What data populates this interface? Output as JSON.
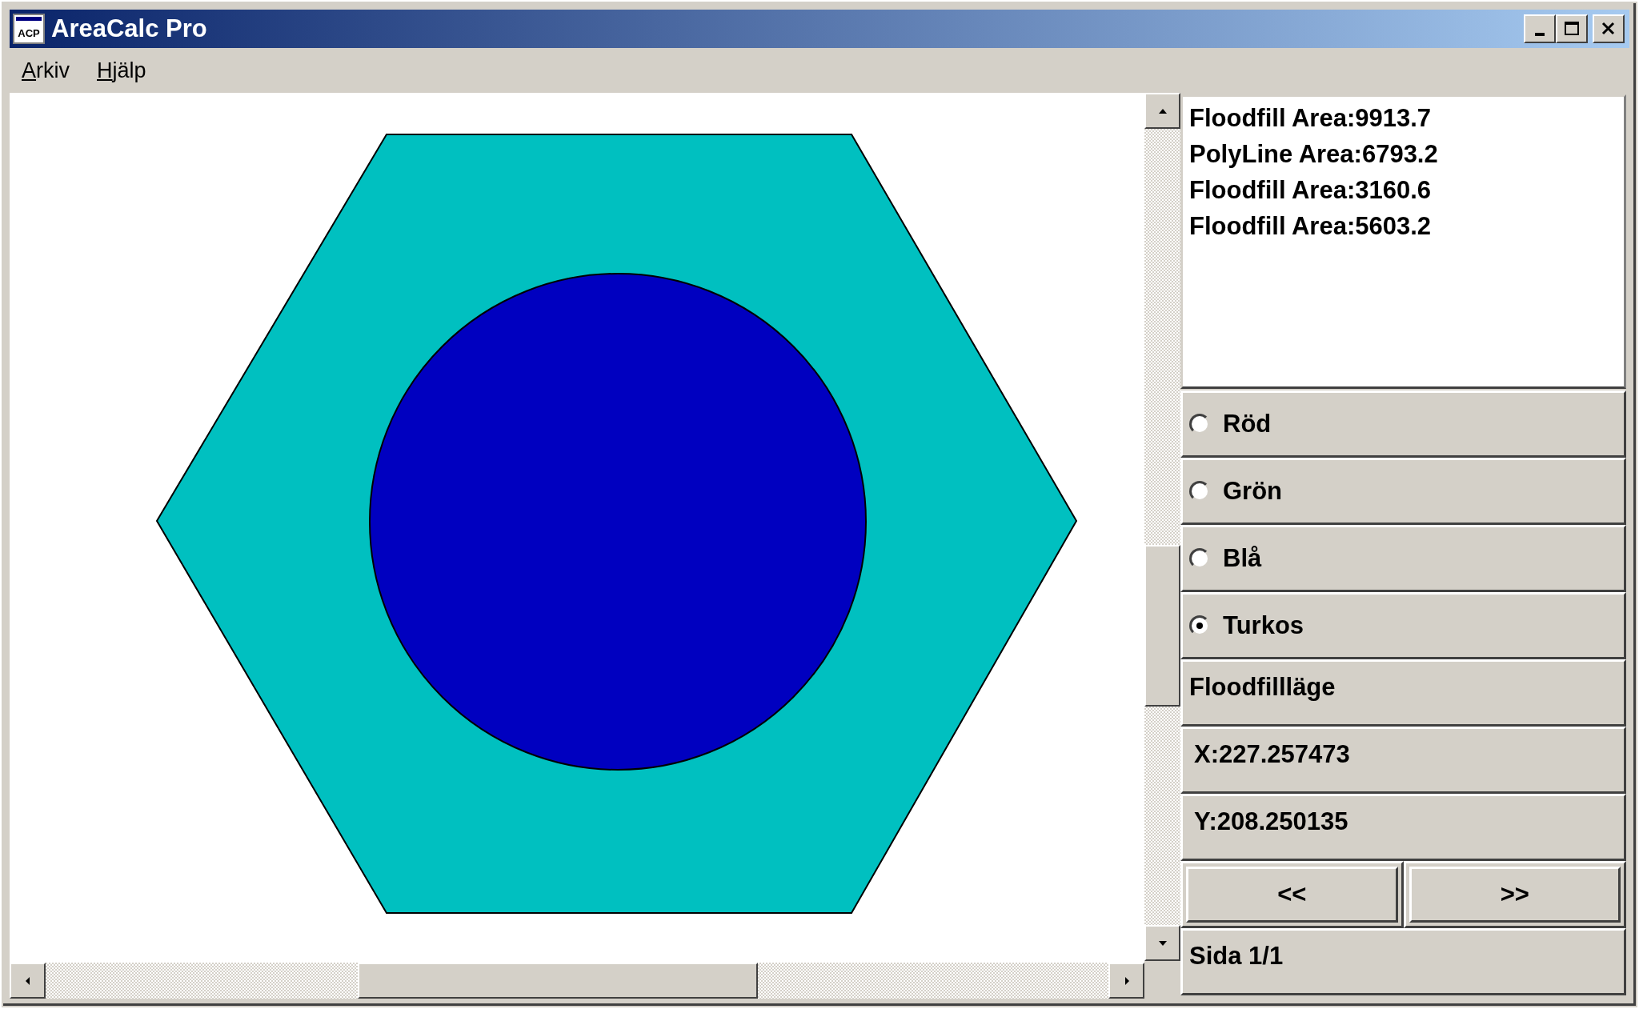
{
  "window": {
    "title": "AreaCalc Pro",
    "icon_text": "ACP"
  },
  "menu": [
    {
      "label": "Arkiv"
    },
    {
      "label": "Hjälp"
    }
  ],
  "canvas": {
    "shapes": [
      {
        "kind": "hexagon",
        "color": "#00c0c0"
      },
      {
        "kind": "circle",
        "color": "#0000c0"
      }
    ]
  },
  "results": [
    "Floodfill Area:9913.7",
    "PolyLine Area:6793.2",
    "Floodfill Area:3160.6",
    "Floodfill Area:5603.2"
  ],
  "colors": [
    {
      "label": "Röd",
      "selected": false
    },
    {
      "label": "Grön",
      "selected": false
    },
    {
      "label": "Blå",
      "selected": false
    },
    {
      "label": "Turkos",
      "selected": true
    }
  ],
  "mode": "Floodfillläge",
  "x": "X:227.257473",
  "y": "Y:208.250135",
  "nav": [
    "<<",
    ">>"
  ],
  "page": "Sida 1/1"
}
